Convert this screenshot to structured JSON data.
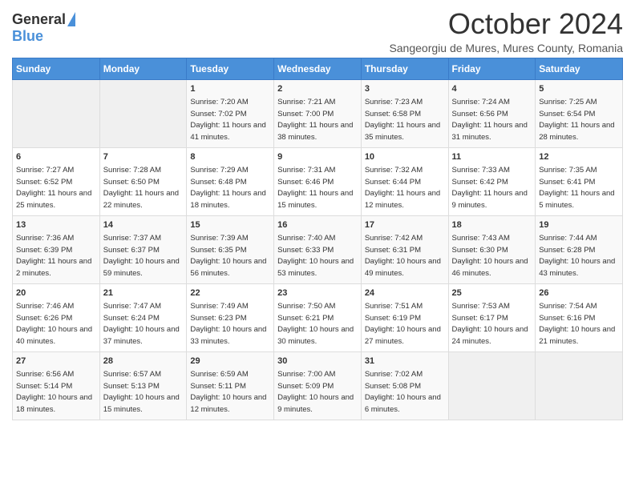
{
  "logo": {
    "general": "General",
    "blue": "Blue"
  },
  "title": "October 2024",
  "subtitle": "Sangeorgiu de Mures, Mures County, Romania",
  "days_of_week": [
    "Sunday",
    "Monday",
    "Tuesday",
    "Wednesday",
    "Thursday",
    "Friday",
    "Saturday"
  ],
  "weeks": [
    [
      {
        "day": "",
        "info": ""
      },
      {
        "day": "",
        "info": ""
      },
      {
        "day": "1",
        "info": "Sunrise: 7:20 AM\nSunset: 7:02 PM\nDaylight: 11 hours and 41 minutes."
      },
      {
        "day": "2",
        "info": "Sunrise: 7:21 AM\nSunset: 7:00 PM\nDaylight: 11 hours and 38 minutes."
      },
      {
        "day": "3",
        "info": "Sunrise: 7:23 AM\nSunset: 6:58 PM\nDaylight: 11 hours and 35 minutes."
      },
      {
        "day": "4",
        "info": "Sunrise: 7:24 AM\nSunset: 6:56 PM\nDaylight: 11 hours and 31 minutes."
      },
      {
        "day": "5",
        "info": "Sunrise: 7:25 AM\nSunset: 6:54 PM\nDaylight: 11 hours and 28 minutes."
      }
    ],
    [
      {
        "day": "6",
        "info": "Sunrise: 7:27 AM\nSunset: 6:52 PM\nDaylight: 11 hours and 25 minutes."
      },
      {
        "day": "7",
        "info": "Sunrise: 7:28 AM\nSunset: 6:50 PM\nDaylight: 11 hours and 22 minutes."
      },
      {
        "day": "8",
        "info": "Sunrise: 7:29 AM\nSunset: 6:48 PM\nDaylight: 11 hours and 18 minutes."
      },
      {
        "day": "9",
        "info": "Sunrise: 7:31 AM\nSunset: 6:46 PM\nDaylight: 11 hours and 15 minutes."
      },
      {
        "day": "10",
        "info": "Sunrise: 7:32 AM\nSunset: 6:44 PM\nDaylight: 11 hours and 12 minutes."
      },
      {
        "day": "11",
        "info": "Sunrise: 7:33 AM\nSunset: 6:42 PM\nDaylight: 11 hours and 9 minutes."
      },
      {
        "day": "12",
        "info": "Sunrise: 7:35 AM\nSunset: 6:41 PM\nDaylight: 11 hours and 5 minutes."
      }
    ],
    [
      {
        "day": "13",
        "info": "Sunrise: 7:36 AM\nSunset: 6:39 PM\nDaylight: 11 hours and 2 minutes."
      },
      {
        "day": "14",
        "info": "Sunrise: 7:37 AM\nSunset: 6:37 PM\nDaylight: 10 hours and 59 minutes."
      },
      {
        "day": "15",
        "info": "Sunrise: 7:39 AM\nSunset: 6:35 PM\nDaylight: 10 hours and 56 minutes."
      },
      {
        "day": "16",
        "info": "Sunrise: 7:40 AM\nSunset: 6:33 PM\nDaylight: 10 hours and 53 minutes."
      },
      {
        "day": "17",
        "info": "Sunrise: 7:42 AM\nSunset: 6:31 PM\nDaylight: 10 hours and 49 minutes."
      },
      {
        "day": "18",
        "info": "Sunrise: 7:43 AM\nSunset: 6:30 PM\nDaylight: 10 hours and 46 minutes."
      },
      {
        "day": "19",
        "info": "Sunrise: 7:44 AM\nSunset: 6:28 PM\nDaylight: 10 hours and 43 minutes."
      }
    ],
    [
      {
        "day": "20",
        "info": "Sunrise: 7:46 AM\nSunset: 6:26 PM\nDaylight: 10 hours and 40 minutes."
      },
      {
        "day": "21",
        "info": "Sunrise: 7:47 AM\nSunset: 6:24 PM\nDaylight: 10 hours and 37 minutes."
      },
      {
        "day": "22",
        "info": "Sunrise: 7:49 AM\nSunset: 6:23 PM\nDaylight: 10 hours and 33 minutes."
      },
      {
        "day": "23",
        "info": "Sunrise: 7:50 AM\nSunset: 6:21 PM\nDaylight: 10 hours and 30 minutes."
      },
      {
        "day": "24",
        "info": "Sunrise: 7:51 AM\nSunset: 6:19 PM\nDaylight: 10 hours and 27 minutes."
      },
      {
        "day": "25",
        "info": "Sunrise: 7:53 AM\nSunset: 6:17 PM\nDaylight: 10 hours and 24 minutes."
      },
      {
        "day": "26",
        "info": "Sunrise: 7:54 AM\nSunset: 6:16 PM\nDaylight: 10 hours and 21 minutes."
      }
    ],
    [
      {
        "day": "27",
        "info": "Sunrise: 6:56 AM\nSunset: 5:14 PM\nDaylight: 10 hours and 18 minutes."
      },
      {
        "day": "28",
        "info": "Sunrise: 6:57 AM\nSunset: 5:13 PM\nDaylight: 10 hours and 15 minutes."
      },
      {
        "day": "29",
        "info": "Sunrise: 6:59 AM\nSunset: 5:11 PM\nDaylight: 10 hours and 12 minutes."
      },
      {
        "day": "30",
        "info": "Sunrise: 7:00 AM\nSunset: 5:09 PM\nDaylight: 10 hours and 9 minutes."
      },
      {
        "day": "31",
        "info": "Sunrise: 7:02 AM\nSunset: 5:08 PM\nDaylight: 10 hours and 6 minutes."
      },
      {
        "day": "",
        "info": ""
      },
      {
        "day": "",
        "info": ""
      }
    ]
  ]
}
